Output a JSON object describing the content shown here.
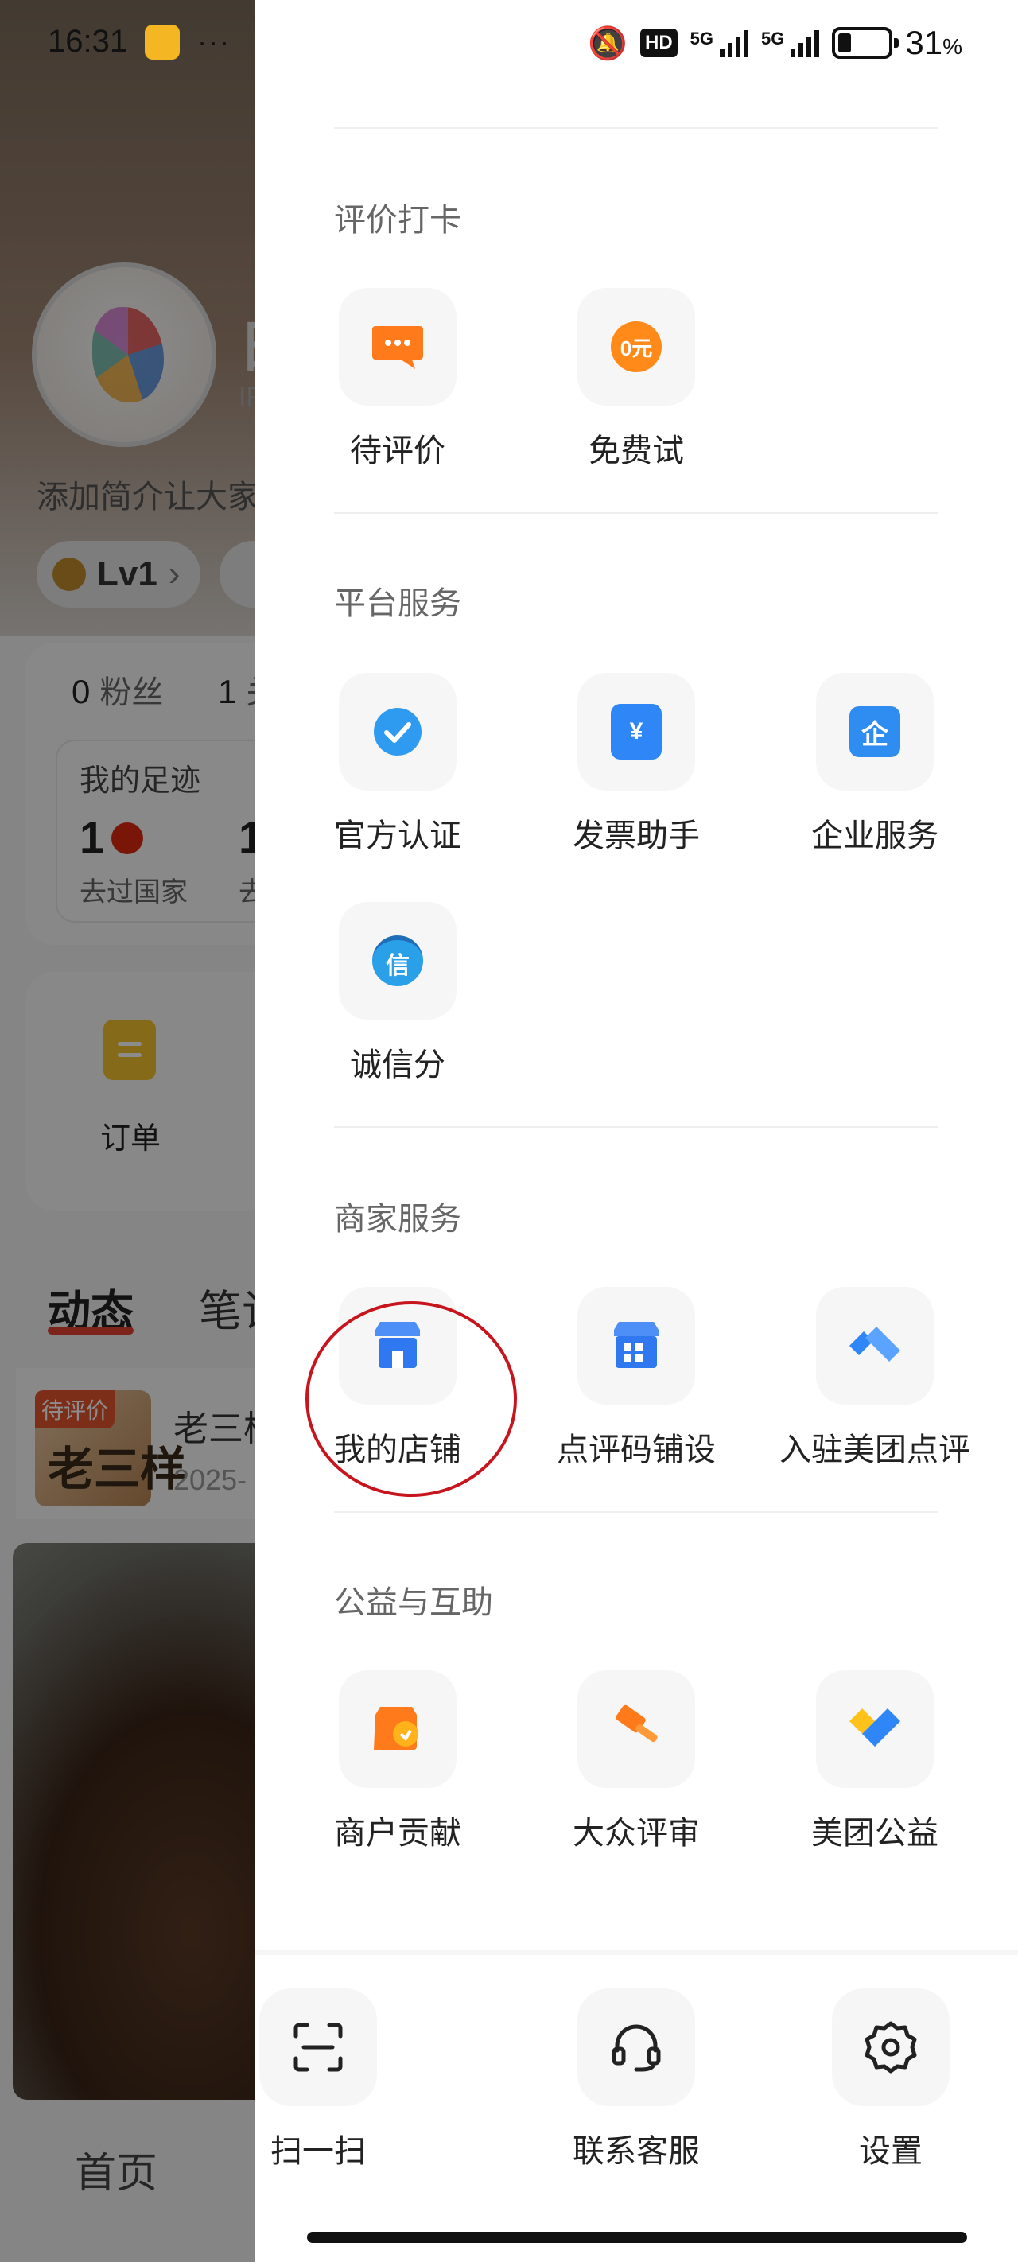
{
  "status_bar": {
    "time": "16:31",
    "more": "···",
    "hd": "HD",
    "net1": "5G",
    "net2": "5G",
    "battery": "31",
    "battery_unit": "%"
  },
  "background": {
    "name_fragment": "日",
    "ip_fragment": "IP",
    "bio": "添加简介让大家",
    "level": "Lv1",
    "fans_count": "0",
    "fans_label": "粉丝",
    "follow_count": "1",
    "follow_label": "关",
    "footprint_title": "我的足迹",
    "countries_count": "1",
    "countries_label": "去过国家",
    "second_count": "1",
    "second_label": "去",
    "order_label": "订单",
    "tab_active": "动态",
    "tab_next": "笔记",
    "feed_tag": "待评价",
    "feed_thumb_text": "老三样",
    "feed_title": "老三样",
    "feed_date": "2025-",
    "home_tab": "首页"
  },
  "sections": [
    {
      "title": "评价打卡",
      "items": [
        {
          "label": "待评价",
          "icon": "message-bubble-icon"
        },
        {
          "label": "免费试",
          "icon": "free-trial-icon",
          "icon_text": "0元"
        }
      ]
    },
    {
      "title": "平台服务",
      "items": [
        {
          "label": "官方认证",
          "icon": "verified-check-icon"
        },
        {
          "label": "发票助手",
          "icon": "invoice-icon",
          "icon_text": "¥"
        },
        {
          "label": "企业服务",
          "icon": "enterprise-icon",
          "icon_text": "企"
        },
        {
          "label": "诚信分",
          "icon": "credit-medal-icon",
          "icon_text": "信"
        }
      ]
    },
    {
      "title": "商家服务",
      "items": [
        {
          "label": "我的店铺",
          "icon": "store-icon"
        },
        {
          "label": "点评码铺设",
          "icon": "qr-store-icon"
        },
        {
          "label": "入驻美团点评",
          "icon": "handshake-icon"
        }
      ]
    },
    {
      "title": "公益与互助",
      "items": [
        {
          "label": "商户贡献",
          "icon": "merchant-contribution-icon"
        },
        {
          "label": "大众评审",
          "icon": "gavel-icon"
        },
        {
          "label": "美团公益",
          "icon": "charity-heart-icon"
        }
      ]
    }
  ],
  "bottom_actions": [
    {
      "label": "扫一扫",
      "icon": "scan-icon"
    },
    {
      "label": "联系客服",
      "icon": "headset-icon"
    },
    {
      "label": "设置",
      "icon": "gear-icon"
    }
  ],
  "colors": {
    "orange": "#ff7a1a",
    "blue": "#2f86f6",
    "annotation_red": "#c8141c"
  }
}
